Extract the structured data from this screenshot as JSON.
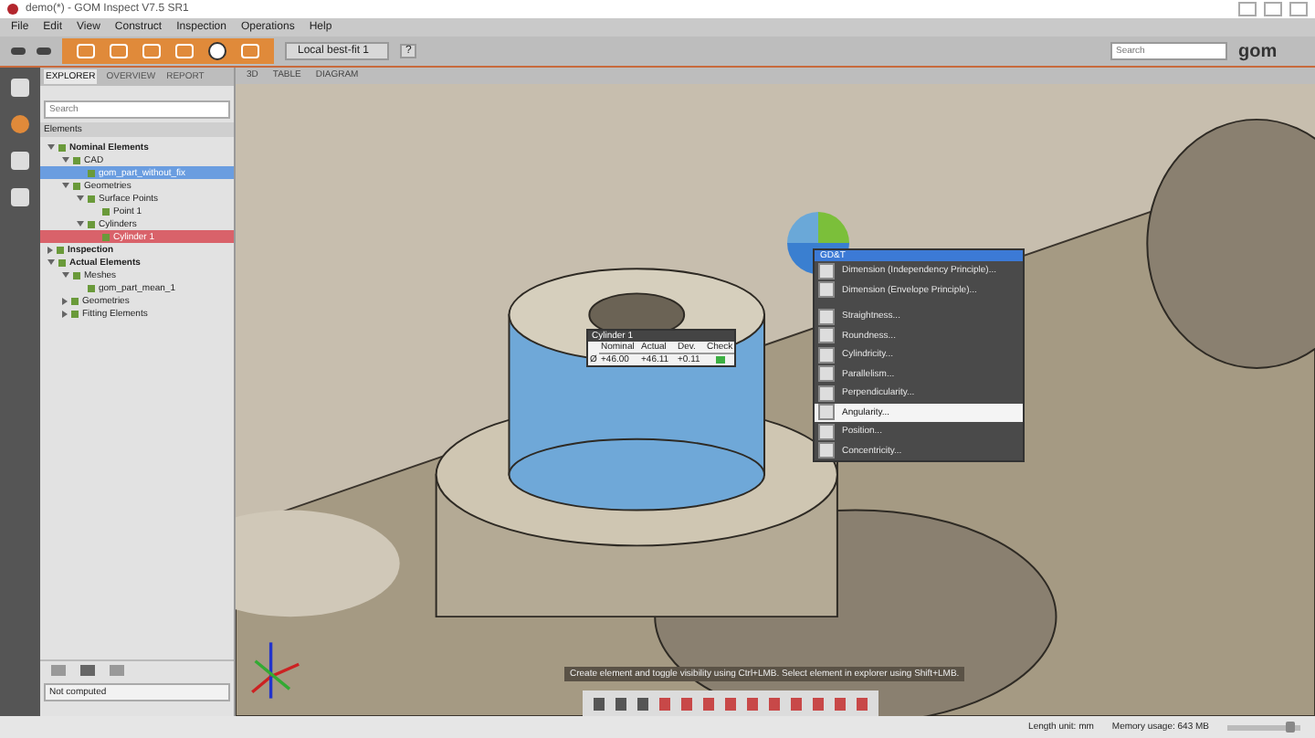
{
  "window": {
    "title": "demo(*) - GOM Inspect V7.5 SR1"
  },
  "menu": [
    "File",
    "Edit",
    "View",
    "Construct",
    "Inspection",
    "Operations",
    "Help"
  ],
  "toolbar": {
    "alignment": "Local best-fit 1",
    "help": "?",
    "search": {
      "placeholder": "Search"
    },
    "logo": "gom"
  },
  "panel_tabs": [
    {
      "label": "EXPLORER",
      "selected": true
    },
    {
      "label": "OVERVIEW",
      "selected": false
    },
    {
      "label": "REPORT",
      "selected": false
    }
  ],
  "view_tabs": [
    "3D",
    "TABLE",
    "DIAGRAM"
  ],
  "explorer": {
    "search": {
      "placeholder": "Search"
    },
    "header": "Elements",
    "tree": [
      {
        "label": "Nominal Elements",
        "expanded": true,
        "selected": false,
        "warning": false,
        "children": [
          {
            "label": "CAD",
            "expanded": true,
            "selected": false,
            "warning": false,
            "children": [
              {
                "label": "gom_part_without_fix",
                "selected": true,
                "warning": false
              }
            ]
          },
          {
            "label": "Geometries",
            "expanded": true,
            "selected": false,
            "warning": false,
            "children": [
              {
                "label": "Surface Points",
                "expanded": true,
                "selected": false,
                "warning": false,
                "children": [
                  {
                    "label": "Point 1",
                    "selected": false,
                    "warning": false
                  }
                ]
              },
              {
                "label": "Cylinders",
                "expanded": true,
                "selected": false,
                "warning": false,
                "children": [
                  {
                    "label": "Cylinder 1",
                    "selected": false,
                    "warning": true
                  }
                ]
              }
            ]
          }
        ]
      },
      {
        "label": "Inspection",
        "expanded": false,
        "selected": false,
        "warning": false
      },
      {
        "label": "Actual Elements",
        "expanded": true,
        "selected": false,
        "warning": false,
        "children": [
          {
            "label": "Meshes",
            "expanded": true,
            "selected": false,
            "warning": false,
            "children": [
              {
                "label": "gom_part_mean_1",
                "selected": false,
                "warning": false
              }
            ]
          },
          {
            "label": "Geometries",
            "expanded": false,
            "selected": false,
            "warning": false
          },
          {
            "label": "Fitting Elements",
            "expanded": false,
            "selected": false,
            "warning": false
          }
        ]
      }
    ],
    "status": "Not computed"
  },
  "label_table": {
    "title": "Cylinder 1",
    "columns": [
      "Nominal",
      "Actual",
      "Dev.",
      "Check"
    ],
    "row": {
      "symbol": "Ø",
      "nominal": "+46.00",
      "actual": "+46.11",
      "dev": "+0.11",
      "passed": true
    }
  },
  "context_menu": {
    "title": "GD&T",
    "items": [
      {
        "label": "Dimension (Independency Principle)...",
        "selected": false
      },
      {
        "label": "Dimension (Envelope Principle)...",
        "selected": false
      },
      {
        "label": "Straightness...",
        "selected": false
      },
      {
        "label": "Roundness...",
        "selected": false
      },
      {
        "label": "Cylindricity...",
        "selected": false
      },
      {
        "label": "Parallelism...",
        "selected": false
      },
      {
        "label": "Perpendicularity...",
        "selected": false
      },
      {
        "label": "Angularity...",
        "selected": true
      },
      {
        "label": "Position...",
        "selected": false
      },
      {
        "label": "Concentricity...",
        "selected": false
      }
    ]
  },
  "hint": "Create element and toggle visibility using Ctrl+LMB. Select element in explorer using Shift+LMB.",
  "status_bar": {
    "length_unit": "Length unit: mm",
    "memory": "Memory usage: 643 MB",
    "zoom": {
      "level": 0.95
    }
  }
}
